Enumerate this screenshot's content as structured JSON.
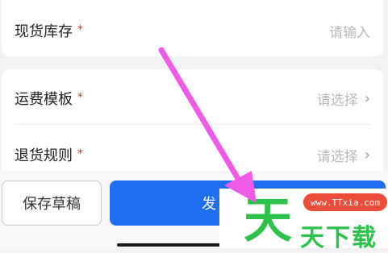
{
  "form": {
    "stock": {
      "label": "现货库存",
      "required_mark": "*",
      "placeholder": "请输入"
    },
    "shipping_template": {
      "label": "运费模板",
      "required_mark": "*",
      "placeholder": "请选择",
      "chevron": "›"
    },
    "return_policy": {
      "label": "退货规则",
      "required_mark": "*",
      "placeholder": "请选择",
      "chevron": "›"
    }
  },
  "actions": {
    "save_draft": "保存草稿",
    "publish_partial": "发"
  },
  "watermark": {
    "url": "www.TTxia.com",
    "logo_char": "天",
    "text": "天下载"
  },
  "colors": {
    "accent_blue": "#1f6ef0",
    "required_red": "#e0303a",
    "annotation_magenta": "#f05ae6",
    "watermark_green": "#2cc24b"
  }
}
